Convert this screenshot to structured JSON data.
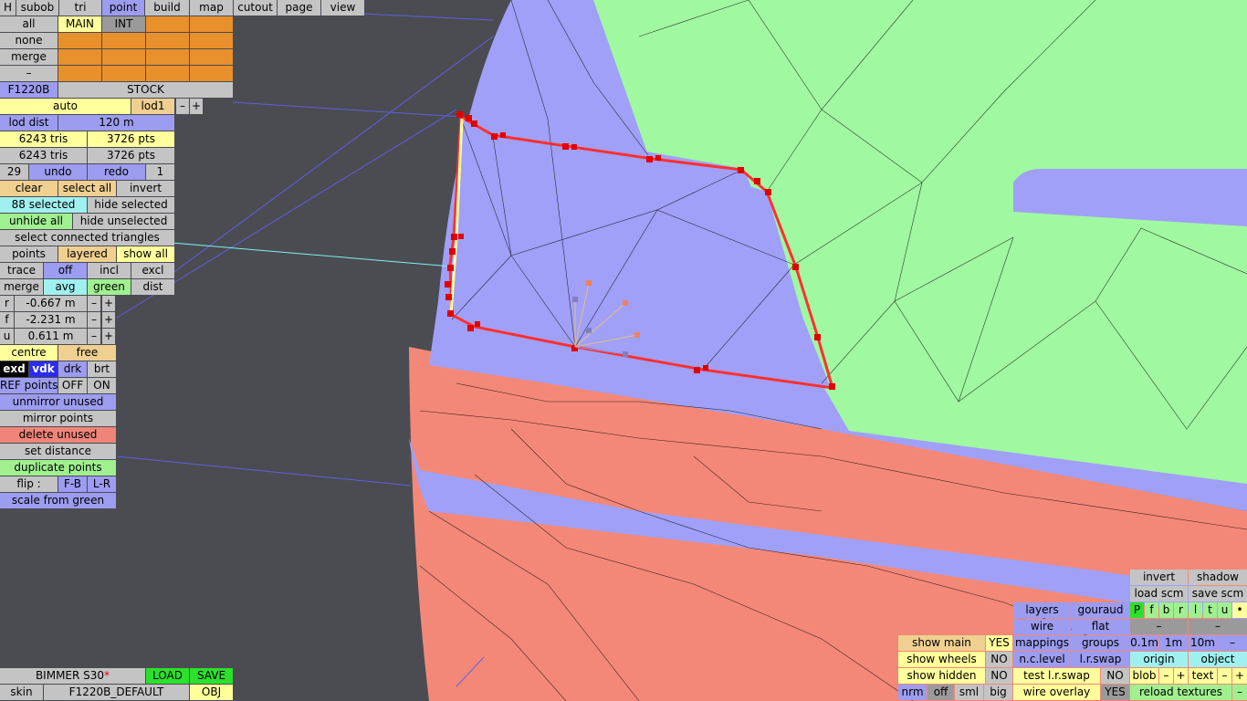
{
  "menu": {
    "h": "H",
    "subob": "subob",
    "tri": "tri",
    "point": "point",
    "build": "build",
    "map": "map",
    "cutout": "cutout",
    "page": "page",
    "view": "view"
  },
  "layers": {
    "all": "all",
    "main": "MAIN",
    "int": "INT",
    "none": "none",
    "merge": "merge",
    "minus": "–"
  },
  "model": {
    "code": "F1220B",
    "variant": "STOCK"
  },
  "lod": {
    "auto": "auto",
    "level": "lod1",
    "minus": "–",
    "plus": "+",
    "dist_label": "lod dist",
    "dist_value": "120 m"
  },
  "stats": {
    "tris1": "6243 tris",
    "pts1": "3726 pts",
    "tris2": "6243 tris",
    "pts2": "3726 pts"
  },
  "history": {
    "count": "29",
    "undo": "undo",
    "redo": "redo",
    "redo_count": "1"
  },
  "selection": {
    "clear": "clear",
    "select_all": "select all",
    "invert": "invert",
    "selected": "88 selected",
    "hide_selected": "hide selected",
    "unhide_all": "unhide all",
    "hide_unselected": "hide unselected",
    "select_connected": "select connected triangles"
  },
  "mode": {
    "points": "points",
    "layered": "layered",
    "show_all": "show all"
  },
  "trace": {
    "label": "trace",
    "off": "off",
    "incl": "incl",
    "excl": "excl"
  },
  "mergeopts": {
    "merge": "merge",
    "avg": "avg",
    "green": "green",
    "dist": "dist"
  },
  "coords": {
    "r_label": "r",
    "r_value": "-0.667 m",
    "f_label": "f",
    "f_value": "-2.231 m",
    "u_label": "u",
    "u_value": "0.611 m",
    "minus": "–",
    "plus": "+"
  },
  "pivot": {
    "centre": "centre",
    "free": "free"
  },
  "display": {
    "exd": "exd",
    "vdk": "vdk",
    "drk": "drk",
    "brt": "brt"
  },
  "ref": {
    "label": "REF points",
    "off": "OFF",
    "on": "ON"
  },
  "actions": {
    "unmirror": "unmirror unused",
    "mirror": "mirror points",
    "delete": "delete unused",
    "set_distance": "set distance",
    "duplicate": "duplicate points",
    "flip_label": "flip :",
    "flip_fb": "F-B",
    "flip_lr": "L-R",
    "scale": "scale from green"
  },
  "file": {
    "car": "BIMMER S30",
    "modified": "*",
    "load": "LOAD",
    "save": "SAVE",
    "skin_label": "skin",
    "skin": "F1220B_DEFAULT",
    "obj": "OBJ"
  },
  "right": {
    "invert": "invert",
    "shadow": "shadow",
    "load_scm": "load scm",
    "save_scm": "save scm",
    "layers": "layers",
    "gouraud": "gouraud",
    "wire": "wire",
    "flat": "flat",
    "mappings": "mappings",
    "groups": "groups",
    "nclevel": "n.c.level",
    "lrswap": "l.r.swap",
    "test_lrswap": "test l.r.swap",
    "test_no": "NO",
    "wire_overlay": "wire overlay",
    "wire_yes": "YES",
    "flags": [
      "P",
      "f",
      "b",
      "r",
      "l",
      "t",
      "u",
      "•"
    ],
    "dash1": "–",
    "dash2": "–",
    "s01": "0.1m",
    "s1": "1m",
    "s10": "10m",
    "sminus": "–",
    "origin": "origin",
    "object": "object",
    "blob": "blob",
    "text": "text",
    "minus": "–",
    "plus": "+",
    "reload": "reload textures",
    "rminus": "–",
    "show_main": "show main",
    "show_main_v": "YES",
    "show_wheels": "show wheels",
    "show_wheels_v": "NO",
    "show_hidden": "show hidden",
    "show_hidden_v": "NO",
    "nrm": "nrm",
    "off": "off",
    "sml": "sml",
    "big": "big"
  },
  "colors": {
    "background": "#4a4c52",
    "panel_grey": "#c4c4c4",
    "panel_blue": "#9c9cf0",
    "panel_yellow": "#ffff9c",
    "orange_cell": "#e8902c",
    "mesh_green": "#a0f8a0",
    "mesh_blue": "#a0a0f8",
    "mesh_salmon": "#f48878",
    "selection": "#ff0000"
  }
}
